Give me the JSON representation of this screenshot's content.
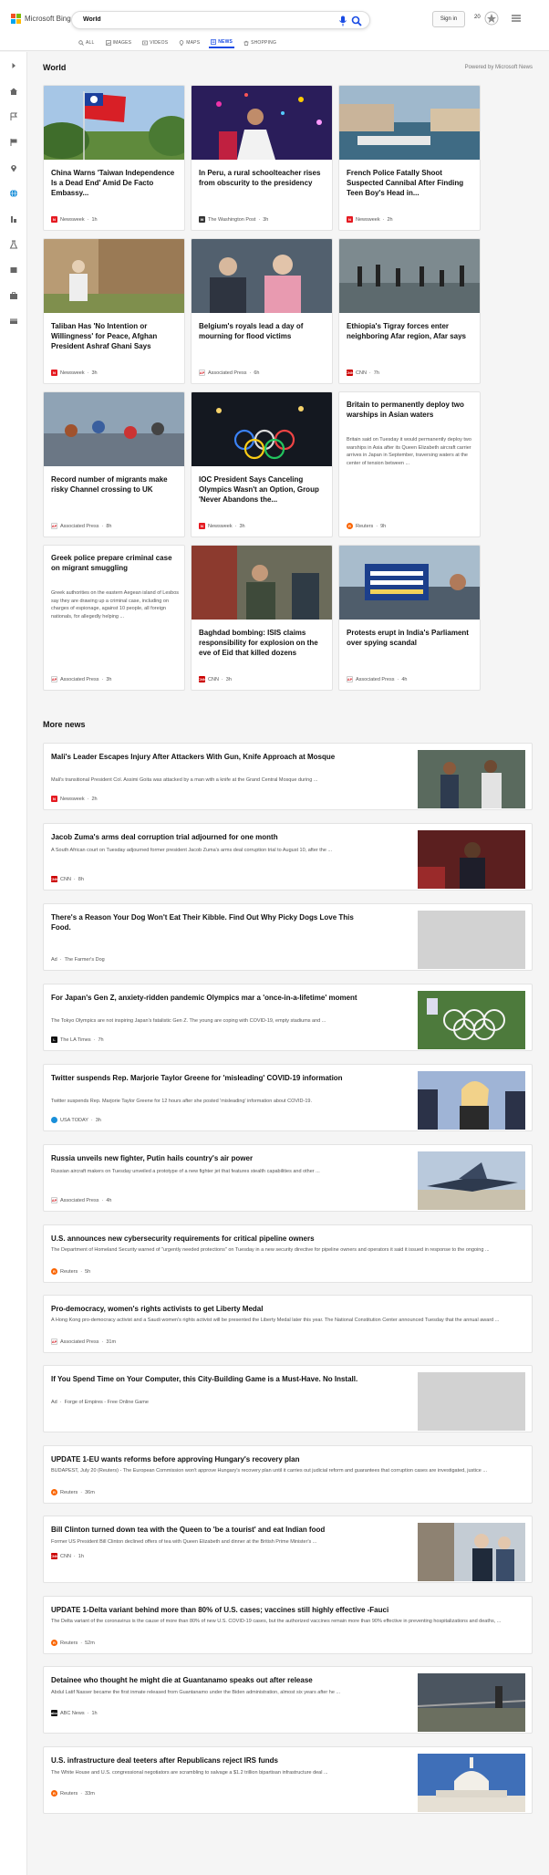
{
  "header": {
    "brand": "Microsoft Bing",
    "query": "World",
    "signin_label": "Sign in",
    "rewards_count": "20",
    "scopes": [
      {
        "label": "ALL",
        "icon": "search-icon"
      },
      {
        "label": "IMAGES",
        "icon": "image-icon"
      },
      {
        "label": "VIDEOS",
        "icon": "video-icon"
      },
      {
        "label": "MAPS",
        "icon": "map-pin-icon"
      },
      {
        "label": "NEWS",
        "icon": "news-icon",
        "active": true
      },
      {
        "label": "SHOPPING",
        "icon": "shopping-icon"
      }
    ]
  },
  "colors": {
    "accent": "#174ae4",
    "newsweek": "#e51a21",
    "ap": "#d8232a",
    "cnn": "#cc0000",
    "reuters": "#fa6400"
  },
  "world": {
    "title": "World",
    "powered": "Powered by Microsoft News",
    "cards": [
      {
        "title": "China Warns 'Taiwan Independence Is a Dead End' Amid De Facto Embassy...",
        "source": "Newsweek",
        "time": "1h",
        "logo": "N"
      },
      {
        "title": "In Peru, a rural schoolteacher rises from obscurity to the presidency",
        "source": "The Washington Post",
        "time": "3h",
        "logo": "W"
      },
      {
        "title": "French Police Fatally Shoot Suspected Cannibal After Finding Teen Boy's Head in...",
        "source": "Newsweek",
        "time": "2h",
        "logo": "N"
      },
      {
        "title": "Taliban Has 'No Intention or Willingness' for Peace, Afghan President Ashraf Ghani Says",
        "source": "Newsweek",
        "time": "3h",
        "logo": "N"
      },
      {
        "title": "Belgium's royals lead a day of mourning for flood victims",
        "source": "Associated Press",
        "time": "6h",
        "logo": "AP"
      },
      {
        "title": "Ethiopia's Tigray forces enter neighboring Afar region, Afar says",
        "source": "CNN",
        "time": "7h",
        "logo": "CNN"
      },
      {
        "title": "Record number of migrants make risky Channel crossing to UK",
        "source": "Associated Press",
        "time": "8h",
        "logo": "AP"
      },
      {
        "title": "IOC President Says Canceling Olympics Wasn't an Option, Group 'Never Abandons the...",
        "source": "Newsweek",
        "time": "3h",
        "logo": "N"
      },
      {
        "title": "Britain to permanently deploy two warships in Asian waters",
        "snippet": "Britain said on Tuesday it would permanently deploy two warships in Asia after its Queen Elizabeth aircraft carrier arrives in Japan in September, traversing waters at the center of tension between ...",
        "source": "Reuters",
        "time": "9h",
        "logo": "R"
      },
      {
        "title": "Greek police prepare criminal case on migrant smuggling",
        "snippet": "Greek authorities on the eastern Aegean island of Lesbos say they are drawing up a criminal case, including on charges of espionage, against 10 people, all foreign nationals, for allegedly helping ...",
        "source": "Associated Press",
        "time": "3h",
        "logo": "AP"
      },
      {
        "title": "Baghdad bombing: ISIS claims responsibility for explosion on the eve of Eid that killed dozens",
        "source": "CNN",
        "time": "3h",
        "logo": "CNN"
      },
      {
        "title": "Protests erupt in India's Parliament over spying scandal",
        "source": "Associated Press",
        "time": "4h",
        "logo": "AP"
      }
    ]
  },
  "more_news": {
    "title": "More news",
    "items": [
      {
        "title": "Mali's Leader Escapes Injury After Attackers With Gun, Knife Approach at Mosque",
        "snippet": "Mali's transitional President Col. Assimi Goita was attacked by a man with a knife at the Grand Central Mosque during ...",
        "source": "Newsweek",
        "time": "2h",
        "logo": "N"
      },
      {
        "title": "Jacob Zuma's arms deal corruption trial adjourned for one month",
        "snippet": "A South African court on Tuesday adjourned former president Jacob Zuma's arms deal corruption trial to August 10, after the ...",
        "source": "CNN",
        "time": "8h",
        "logo": "CNN"
      },
      {
        "title": "There's a Reason Your Dog Won't Eat Their Kibble. Find Out Why Picky Dogs Love This Food.",
        "snippet": "",
        "source": "The Farmer's Dog",
        "ad": "Ad",
        "time": ""
      },
      {
        "title": "For Japan's Gen Z, anxiety-ridden pandemic Olympics mar a 'once-in-a-lifetime' moment",
        "snippet": "The Tokyo Olympics are not inspiring Japan's fatalistic Gen Z. The young are coping with COVID-19, empty stadiums and ...",
        "source": "The LA Times",
        "time": "7h",
        "logo": "L"
      },
      {
        "title": "Twitter suspends Rep. Marjorie Taylor Greene for 'misleading' COVID-19 information",
        "snippet": "Twitter suspends Rep. Marjorie Taylor Greene for 12 hours after she posted 'misleading' information about COVID-19.",
        "source": "USA TODAY",
        "time": "3h",
        "logo": ""
      },
      {
        "title": "Russia unveils new fighter, Putin hails country's air power",
        "snippet": "Russian aircraft makers on Tuesday unveiled a prototype of a new fighter jet that features stealth capabilities and other ...",
        "source": "Associated Press",
        "time": "4h",
        "logo": "AP"
      },
      {
        "title": "U.S. announces new cybersecurity requirements for critical pipeline owners",
        "snippet": "The Department of Homeland Security warned of \"urgently needed protections\" on Tuesday in a new security directive for pipeline owners and operators it said it issued in response to the ongoing ...",
        "source": "Reuters",
        "time": "5h",
        "logo": "R"
      },
      {
        "title": "Pro-democracy, women's rights activists to get Liberty Medal",
        "snippet": "A Hong Kong pro-democracy activist and a Saudi women's rights activist will be presented the Liberty Medal later this year. The National Constitution Center announced Tuesday that the annual award ...",
        "source": "Associated Press",
        "time": "31m",
        "logo": "AP"
      },
      {
        "title": "If You Spend Time on Your Computer, this City-Building Game is a Must-Have. No Install.",
        "snippet": "",
        "source": "Forge of Empires - Free Online Game",
        "ad": "Ad",
        "time": ""
      },
      {
        "title": "UPDATE 1-EU wants reforms before approving Hungary's recovery plan",
        "snippet": "BUDAPEST, July 20 (Reuters) - The European Commission won't approve Hungary's recovery plan until it carries out judicial reform and guarantees that corruption cases are investigated, justice ...",
        "source": "Reuters",
        "time": "36m",
        "logo": "R"
      },
      {
        "title": "Bill Clinton turned down tea with the Queen to 'be a tourist' and eat Indian food",
        "snippet": "Former US President Bill Clinton declined offers of tea with Queen Elizabeth and dinner at the British Prime Minister's ...",
        "source": "CNN",
        "time": "1h",
        "logo": "CNN"
      },
      {
        "title": "UPDATE 1-Delta variant behind more than 80% of U.S. cases; vaccines still highly effective -Fauci",
        "snippet": "The Delta variant of the coronavirus is the cause of more than 80% of new U.S. COVID-19 cases, but the authorized vaccines remain more than 90% effective in preventing hospitalizations and deaths, ...",
        "source": "Reuters",
        "time": "52m",
        "logo": "R"
      },
      {
        "title": "Detainee who thought he might die at Guantanamo speaks out after release",
        "snippet": "Abdul Latif Nasser became the first inmate released from Guantanamo under the Biden administration, almost six years after he ...",
        "source": "ABC News",
        "time": "1h",
        "logo": "abc"
      },
      {
        "title": "U.S. infrastructure deal teeters after Republicans reject IRS funds",
        "snippet": "The White House and U.S. congressional negotiators are scrambling to salvage a $1.2 trillion bipartisan infrastructure deal ...",
        "source": "Reuters",
        "time": "33m",
        "logo": "R"
      }
    ]
  }
}
